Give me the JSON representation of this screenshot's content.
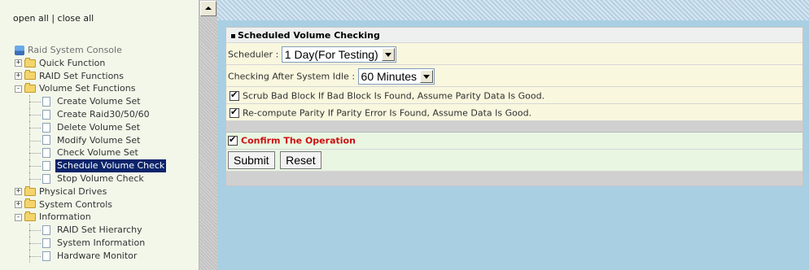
{
  "nav": {
    "top_links": {
      "open_all": "open all",
      "separator": "|",
      "close_all": "close all"
    },
    "root": "Raid System Console",
    "tree": [
      {
        "label": "Quick Function",
        "toggle": "+"
      },
      {
        "label": "RAID Set Functions",
        "toggle": "+"
      },
      {
        "label": "Volume Set Functions",
        "toggle": "-"
      },
      {
        "label": "Create Volume Set"
      },
      {
        "label": "Create Raid30/50/60"
      },
      {
        "label": "Delete Volume Set"
      },
      {
        "label": "Modify Volume Set"
      },
      {
        "label": "Check Volume Set"
      },
      {
        "label": "Schedule Volume Check",
        "selected": true
      },
      {
        "label": "Stop Volume Check"
      },
      {
        "label": "Physical Drives",
        "toggle": "+"
      },
      {
        "label": "System Controls",
        "toggle": "+"
      },
      {
        "label": "Information",
        "toggle": "-"
      },
      {
        "label": "RAID Set Hierarchy"
      },
      {
        "label": "System Information"
      },
      {
        "label": "Hardware Monitor"
      }
    ]
  },
  "panel": {
    "title": "Scheduled Volume Checking",
    "scheduler_label": "Scheduler :",
    "scheduler_value": "1 Day(For Testing)",
    "idle_label": "Checking After System Idle :",
    "idle_value": "60 Minutes",
    "scrub_label": "Scrub Bad Block If Bad Block Is Found, Assume Parity Data Is Good.",
    "recompute_label": "Re-compute Parity If Parity Error Is Found, Assume Data Is Good.",
    "confirm_label": "Confirm The Operation",
    "submit_label": "Submit",
    "reset_label": "Reset"
  },
  "colors": {
    "selected_bg": "#0a246a",
    "confirm_text": "#cc1111",
    "main_bg": "#a9cfe3",
    "panel_bg": "#f9f7de"
  }
}
